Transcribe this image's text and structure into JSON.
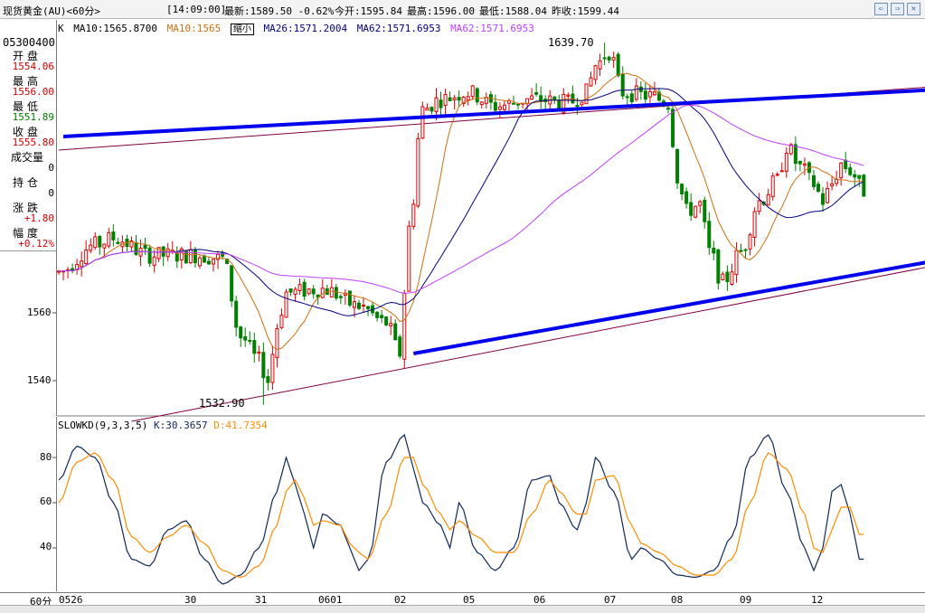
{
  "titlebar": {
    "instrument": "现货黄金(AU)<60分>",
    "time": "[14:09:00]",
    "latest": "最新:1589.50 -0.62%",
    "open_today": "今开:1595.84",
    "high": "最高:1596.00",
    "low": "最低:1588.04",
    "prev_close": "昨收:1599.44"
  },
  "legend": {
    "k": "K",
    "ma10a": "MA10:1565.8700",
    "ma10b": "MA10:1565",
    "shrink": "缩小",
    "ma26": "MA26:1571.2004",
    "ma62a": "MA62:1571.6953",
    "ma62b": "MA62:1571.6953"
  },
  "left_panel": {
    "code": "05300400",
    "open_label": "开盘",
    "open_value": "1554.06",
    "high_label": "最高",
    "high_value": "1556.00",
    "low_label": "最低",
    "low_value": "1551.89",
    "close_label": "收盘",
    "close_value": "1555.80",
    "volume_label": "成交量",
    "volume_value": "0",
    "position_label": "持仓",
    "position_value": "0",
    "change_label": "涨跌",
    "change_value": "+1.80",
    "amp_label": "幅度",
    "amp_value": "+0.12%"
  },
  "kd": {
    "title": "SLOWKD(9,3,3,5)",
    "k_label": "K:30.3657",
    "d_label": "D:41.7354",
    "yticks": [
      "80",
      "60",
      "40"
    ]
  },
  "period_label": "60分",
  "colors": {
    "up": "#e00000",
    "down": "#008000",
    "ma10": "#d07010",
    "ma26": "#000080",
    "ma62": "#c040ff",
    "trend_arrow": "#0000ee",
    "channel": "#800040",
    "kd_k": "#10285a",
    "kd_d": "#ff8c00"
  },
  "chart_data": {
    "type": "candlestick",
    "ylim": [
      1530,
      1645
    ],
    "yticks": [
      1560,
      1540
    ],
    "x_tick_labels": [
      "0526",
      "30",
      "31",
      "0601",
      "02",
      "05",
      "06",
      "07",
      "08",
      "09",
      "12"
    ],
    "annotations": [
      {
        "text": "1639.70",
        "bar": 120,
        "value": 1639.7
      },
      {
        "text": "1532.90",
        "bar": 45,
        "value": 1532.9
      }
    ],
    "anchors": [
      {
        "bar": 0,
        "price": 1572
      },
      {
        "bar": 8,
        "price": 1580
      },
      {
        "bar": 12,
        "price": 1582
      },
      {
        "bar": 20,
        "price": 1577
      },
      {
        "bar": 30,
        "price": 1577
      },
      {
        "bar": 36,
        "price": 1576
      },
      {
        "bar": 40,
        "price": 1553
      },
      {
        "bar": 44,
        "price": 1546
      },
      {
        "bar": 46,
        "price": 1540
      },
      {
        "bar": 48,
        "price": 1556
      },
      {
        "bar": 50,
        "price": 1566
      },
      {
        "bar": 58,
        "price": 1567
      },
      {
        "bar": 66,
        "price": 1562
      },
      {
        "bar": 72,
        "price": 1557
      },
      {
        "bar": 75,
        "price": 1548
      },
      {
        "bar": 77,
        "price": 1585
      },
      {
        "bar": 80,
        "price": 1620
      },
      {
        "bar": 84,
        "price": 1623
      },
      {
        "bar": 90,
        "price": 1625
      },
      {
        "bar": 96,
        "price": 1621
      },
      {
        "bar": 104,
        "price": 1623
      },
      {
        "bar": 112,
        "price": 1622
      },
      {
        "bar": 116,
        "price": 1625
      },
      {
        "bar": 118,
        "price": 1633
      },
      {
        "bar": 121,
        "price": 1637
      },
      {
        "bar": 124,
        "price": 1625
      },
      {
        "bar": 130,
        "price": 1624
      },
      {
        "bar": 134,
        "price": 1622
      },
      {
        "bar": 136,
        "price": 1600
      },
      {
        "bar": 138,
        "price": 1590
      },
      {
        "bar": 141,
        "price": 1592
      },
      {
        "bar": 143,
        "price": 1578
      },
      {
        "bar": 146,
        "price": 1569
      },
      {
        "bar": 150,
        "price": 1578
      },
      {
        "bar": 154,
        "price": 1593
      },
      {
        "bar": 158,
        "price": 1599
      },
      {
        "bar": 160,
        "price": 1609
      },
      {
        "bar": 163,
        "price": 1603
      },
      {
        "bar": 166,
        "price": 1598
      },
      {
        "bar": 168,
        "price": 1593
      },
      {
        "bar": 170,
        "price": 1598
      },
      {
        "bar": 172,
        "price": 1604
      },
      {
        "bar": 174,
        "price": 1602
      },
      {
        "bar": 177,
        "price": 1596
      }
    ],
    "trendlines": [
      {
        "type": "arrow",
        "from": [
          1,
          1612
        ],
        "to": [
          209,
          1627
        ]
      },
      {
        "type": "arrow",
        "from": [
          78,
          1548
        ],
        "to": [
          208,
          1579
        ]
      },
      {
        "type": "channel",
        "from": [
          0,
          1608
        ],
        "to": [
          216,
          1629
        ]
      },
      {
        "type": "channel",
        "from": [
          16,
          1528
        ],
        "to": [
          216,
          1580
        ]
      }
    ],
    "kd_ylim": [
      20,
      100
    ],
    "kd_k_anchors": [
      [
        0,
        70
      ],
      [
        4,
        85
      ],
      [
        8,
        80
      ],
      [
        12,
        60
      ],
      [
        16,
        35
      ],
      [
        20,
        32
      ],
      [
        24,
        48
      ],
      [
        28,
        52
      ],
      [
        32,
        35
      ],
      [
        36,
        24
      ],
      [
        40,
        28
      ],
      [
        44,
        40
      ],
      [
        48,
        65
      ],
      [
        50,
        80
      ],
      [
        52,
        68
      ],
      [
        54,
        55
      ],
      [
        56,
        40
      ],
      [
        58,
        55
      ],
      [
        62,
        50
      ],
      [
        64,
        40
      ],
      [
        66,
        30
      ],
      [
        68,
        35
      ],
      [
        72,
        78
      ],
      [
        76,
        90
      ],
      [
        78,
        75
      ],
      [
        80,
        60
      ],
      [
        84,
        50
      ],
      [
        86,
        40
      ],
      [
        88,
        60
      ],
      [
        92,
        38
      ],
      [
        96,
        30
      ],
      [
        100,
        40
      ],
      [
        104,
        70
      ],
      [
        108,
        72
      ],
      [
        110,
        60
      ],
      [
        114,
        48
      ],
      [
        116,
        60
      ],
      [
        118,
        80
      ],
      [
        122,
        65
      ],
      [
        126,
        35
      ],
      [
        128,
        40
      ],
      [
        132,
        35
      ],
      [
        136,
        28
      ],
      [
        140,
        27
      ],
      [
        144,
        30
      ],
      [
        148,
        45
      ],
      [
        152,
        80
      ],
      [
        156,
        90
      ],
      [
        160,
        65
      ],
      [
        164,
        40
      ],
      [
        166,
        30
      ],
      [
        168,
        40
      ],
      [
        170,
        65
      ],
      [
        172,
        68
      ],
      [
        174,
        55
      ],
      [
        176,
        35
      ]
    ],
    "kd_d_anchors": [
      [
        0,
        60
      ],
      [
        4,
        78
      ],
      [
        8,
        82
      ],
      [
        12,
        70
      ],
      [
        16,
        45
      ],
      [
        20,
        38
      ],
      [
        24,
        45
      ],
      [
        28,
        50
      ],
      [
        32,
        42
      ],
      [
        36,
        30
      ],
      [
        40,
        27
      ],
      [
        44,
        32
      ],
      [
        48,
        50
      ],
      [
        50,
        65
      ],
      [
        52,
        70
      ],
      [
        54,
        62
      ],
      [
        56,
        50
      ],
      [
        58,
        52
      ],
      [
        62,
        50
      ],
      [
        64,
        42
      ],
      [
        66,
        38
      ],
      [
        68,
        35
      ],
      [
        72,
        55
      ],
      [
        76,
        80
      ],
      [
        78,
        80
      ],
      [
        80,
        68
      ],
      [
        84,
        55
      ],
      [
        86,
        48
      ],
      [
        88,
        52
      ],
      [
        92,
        45
      ],
      [
        96,
        38
      ],
      [
        100,
        38
      ],
      [
        104,
        55
      ],
      [
        108,
        70
      ],
      [
        110,
        65
      ],
      [
        114,
        55
      ],
      [
        116,
        55
      ],
      [
        118,
        70
      ],
      [
        122,
        72
      ],
      [
        126,
        50
      ],
      [
        128,
        42
      ],
      [
        132,
        38
      ],
      [
        136,
        32
      ],
      [
        140,
        28
      ],
      [
        144,
        28
      ],
      [
        148,
        35
      ],
      [
        152,
        60
      ],
      [
        156,
        82
      ],
      [
        160,
        75
      ],
      [
        164,
        55
      ],
      [
        166,
        40
      ],
      [
        168,
        38
      ],
      [
        170,
        48
      ],
      [
        172,
        58
      ],
      [
        174,
        58
      ],
      [
        176,
        46
      ]
    ]
  }
}
